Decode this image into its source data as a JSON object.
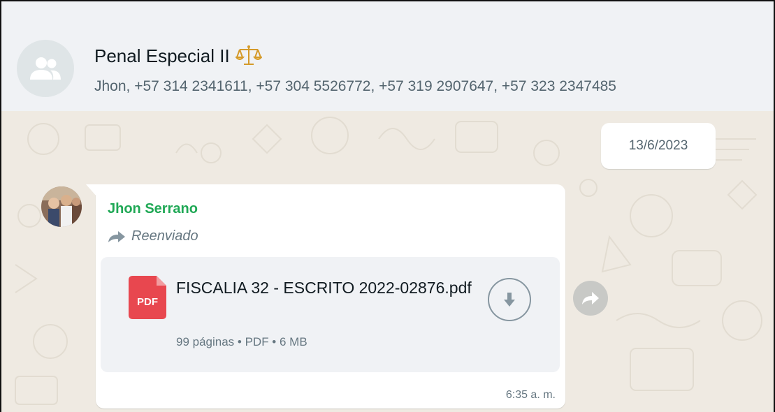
{
  "header": {
    "title": "Penal Especial II",
    "members": "Jhon, +57 314 2341611, +57 304 5526772, +57 319 2907647, +57 323 2347485",
    "avatar_icon": "group-icon",
    "title_emoji_icon": "balance-scale-icon"
  },
  "chat": {
    "date_chip": "13/6/2023",
    "message": {
      "sender": "Jhon Serrano",
      "forwarded_label": "Reenviado",
      "document": {
        "icon_label": "PDF",
        "filename": "FISCALIA 32 - ESCRITO 2022-02876.pdf",
        "meta": "99 páginas • PDF • 6 MB"
      },
      "time": "6:35 a. m."
    }
  },
  "colors": {
    "header_bg": "#f0f2f5",
    "chat_bg": "#efeae2",
    "sender_name": "#1fa855",
    "pdf_red": "#e8474f"
  }
}
